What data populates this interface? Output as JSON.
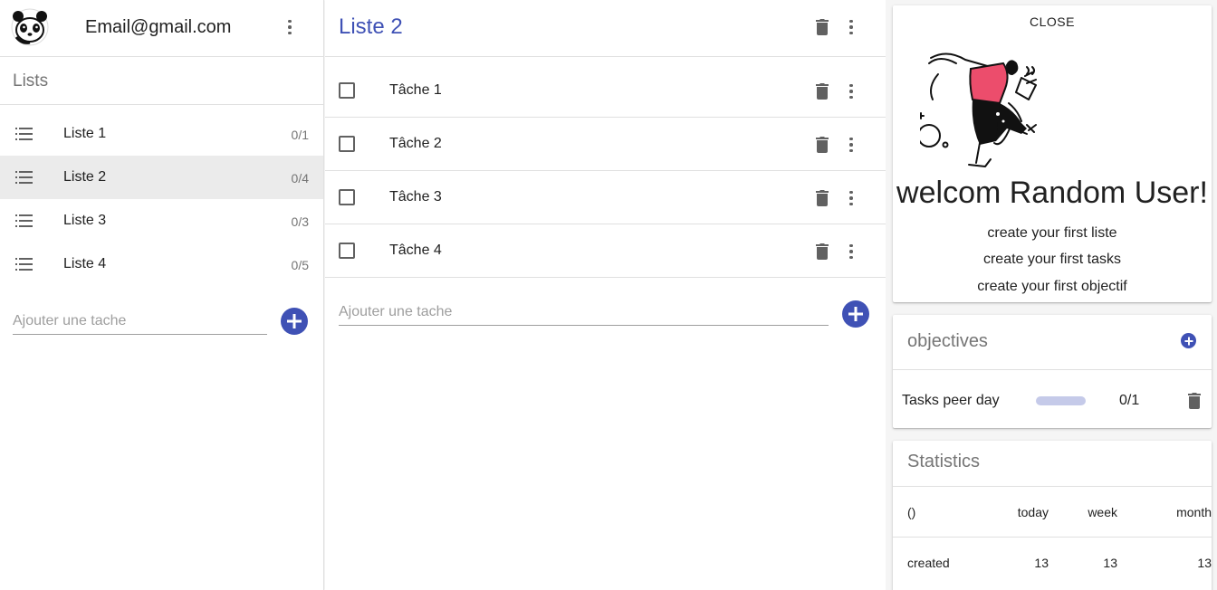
{
  "sidebar": {
    "email": "Email@gmail.com",
    "section_title": "Lists",
    "items": [
      {
        "label": "Liste 1",
        "count": "0/1"
      },
      {
        "label": "Liste 2",
        "count": "0/4"
      },
      {
        "label": "Liste 3",
        "count": "0/3"
      },
      {
        "label": "Liste 4",
        "count": "0/5"
      }
    ],
    "selected_index": 1,
    "add_placeholder": "Ajouter une tache"
  },
  "main": {
    "title": "Liste 2",
    "tasks": [
      {
        "label": "Tâche 1",
        "checked": false
      },
      {
        "label": "Tâche 2",
        "checked": false
      },
      {
        "label": "Tâche 3",
        "checked": false
      },
      {
        "label": "Tâche 4",
        "checked": false
      }
    ],
    "add_placeholder": "Ajouter une tache"
  },
  "welcome": {
    "close_label": "CLOSE",
    "title": "welcom Random User!",
    "lines": [
      "create your first liste",
      "create your first tasks",
      "create your first objectif"
    ]
  },
  "objectives": {
    "title": "objectives",
    "items": [
      {
        "label": "Tasks peer day",
        "count": "0/1",
        "progress": 0
      }
    ]
  },
  "statistics": {
    "title": "Statistics",
    "columns": [
      "()",
      "today",
      "week",
      "month"
    ],
    "rows": [
      [
        "created",
        "13",
        "13",
        "13"
      ]
    ]
  },
  "colors": {
    "primary": "#3f51b5",
    "progress_track": "#c5cae9",
    "selected_row": "#ebebeb"
  },
  "icons": {
    "avatar": "panda-avatar",
    "list": "list-icon",
    "menu": "more-vert-icon",
    "delete": "trash-icon",
    "add": "add-circle-icon",
    "checkbox": "checkbox-outline-icon"
  }
}
